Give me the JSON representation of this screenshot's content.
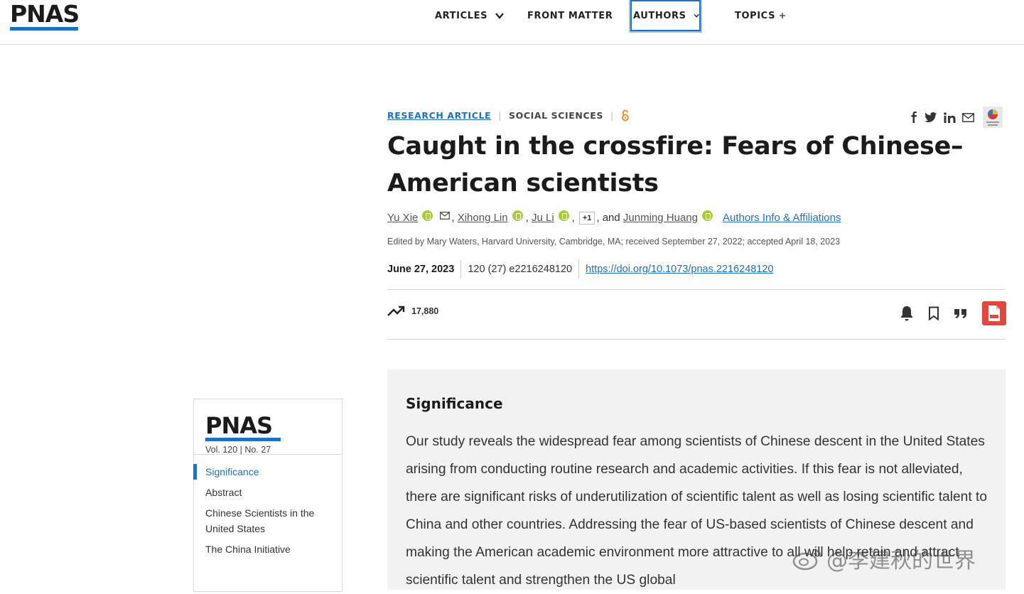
{
  "header": {
    "logo": "PNAS",
    "nav": {
      "articles": "ARTICLES",
      "front_matter": "FRONT MATTER",
      "authors": "AUTHORS",
      "topics": "TOPICS"
    }
  },
  "article": {
    "type": "RESEARCH ARTICLE",
    "section": "SOCIAL SCIENCES",
    "title": "Caught in the crossfire: Fears of Chinese–American scientists",
    "authors": [
      "Yu Xie",
      "Xihong Lin",
      "Ju Li",
      "Junming Huang"
    ],
    "more_authors": "+1",
    "and_text": ", and",
    "affiliations_link": "Authors Info & Affiliations",
    "edited_by": "Edited by Mary Waters, Harvard University, Cambridge, MA; received September 27, 2022; accepted April 18, 2023",
    "date": "June 27, 2023",
    "citation": "120 (27) e2216248120",
    "doi": "https://doi.org/10.1073/pnas.2216248120",
    "views": "17,880"
  },
  "significance": {
    "heading": "Significance",
    "body": "Our study reveals the widespread fear among scientists of Chinese descent in the United States arising from conducting routine research and academic activities. If this fear is not alleviated, there are significant risks of underutilization of scientific talent as well as losing scientific talent to China and other countries. Addressing the fear of US-based scientists of Chinese descent and making the American academic environment more attractive to all will help retain and attract scientific talent and strengthen the US global"
  },
  "sidebar": {
    "logo": "PNAS",
    "volume": "Vol. 120 | No. 27",
    "toc": [
      "Significance",
      "Abstract",
      "Chinese Scientists in the United States",
      "The China Initiative"
    ]
  },
  "watermark": "@李建秋的世界",
  "icons": [
    "chevron-down-icon",
    "plus-icon",
    "open-access-icon",
    "facebook-icon",
    "twitter-icon",
    "linkedin-icon",
    "mail-icon",
    "check-updates-icon",
    "orcid-icon",
    "trending-icon",
    "bell-icon",
    "bookmark-icon",
    "quote-icon",
    "pdf-icon"
  ],
  "colors": {
    "accent": "#1f6fc2",
    "orcid": "#a6ce39",
    "pdf": "#e3463d",
    "open_access": "#f28c28"
  }
}
